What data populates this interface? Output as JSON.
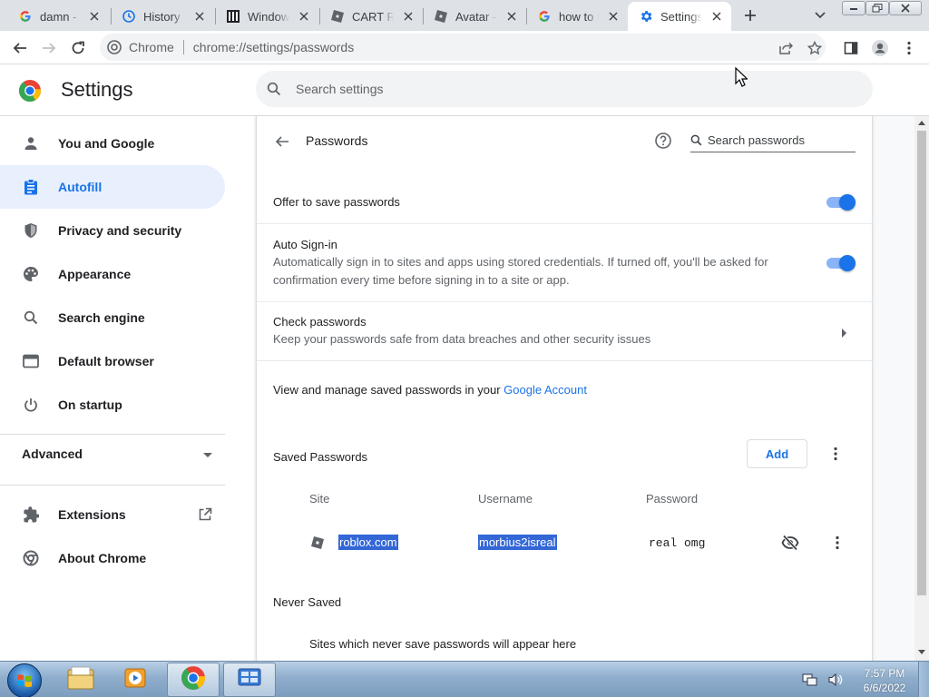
{
  "tabs": [
    {
      "title": "damn - G",
      "icon": "google-icon"
    },
    {
      "title": "History",
      "icon": "history-icon"
    },
    {
      "title": "Windows",
      "icon": "windows-site-icon"
    },
    {
      "title": "CART RID",
      "icon": "roblox-icon"
    },
    {
      "title": "Avatar - R",
      "icon": "roblox-icon"
    },
    {
      "title": "how to fi",
      "icon": "google-icon"
    },
    {
      "title": "Settings",
      "icon": "settings-gear-icon",
      "active": true
    }
  ],
  "toolbar": {
    "site_label": "Chrome",
    "url": "chrome://settings/passwords"
  },
  "settings": {
    "title": "Settings",
    "search_placeholder": "Search settings"
  },
  "sidebar": {
    "items": [
      {
        "label": "You and Google",
        "icon": "person-icon"
      },
      {
        "label": "Autofill",
        "icon": "autofill-clipboard-icon",
        "active": true
      },
      {
        "label": "Privacy and security",
        "icon": "shield-icon"
      },
      {
        "label": "Appearance",
        "icon": "palette-icon"
      },
      {
        "label": "Search engine",
        "icon": "search-icon"
      },
      {
        "label": "Default browser",
        "icon": "browser-window-icon"
      },
      {
        "label": "On startup",
        "icon": "power-icon"
      }
    ],
    "advanced_label": "Advanced",
    "extensions_label": "Extensions",
    "about_label": "About Chrome"
  },
  "passwords": {
    "page_title": "Passwords",
    "search_placeholder": "Search passwords",
    "offer_label": "Offer to save passwords",
    "offer_enabled": true,
    "autosignin_title": "Auto Sign-in",
    "autosignin_desc": "Automatically sign in to sites and apps using stored credentials. If turned off, you'll be asked for confirmation every time before signing in to a site or app.",
    "autosignin_enabled": true,
    "check_title": "Check passwords",
    "check_desc": "Keep your passwords safe from data breaches and other security issues",
    "manage_text": "View and manage saved passwords in your",
    "manage_link": "Google Account",
    "saved_title": "Saved Passwords",
    "add_label": "Add",
    "columns": {
      "site": "Site",
      "username": "Username",
      "password": "Password"
    },
    "entries": [
      {
        "site": "roblox.com",
        "username": "morbius2isreal",
        "password": "real omg"
      }
    ],
    "never_saved_title": "Never Saved",
    "never_saved_empty": "Sites which never save passwords will appear here"
  },
  "taskbar": {
    "time": "7:57 PM",
    "date": "6/6/2022"
  },
  "colors": {
    "accent": "#1a73e8",
    "selection": "#3367d6",
    "active_nav_bg": "#e8f0fe"
  }
}
